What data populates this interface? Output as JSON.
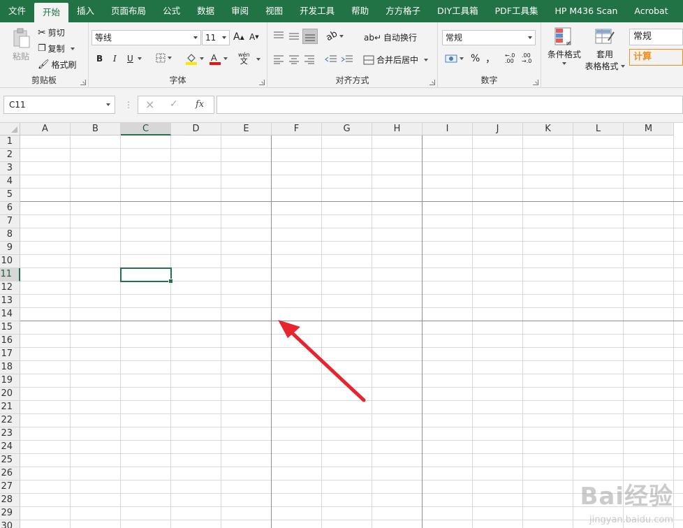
{
  "ribbon_tabs": [
    "文件",
    "开始",
    "插入",
    "页面布局",
    "公式",
    "数据",
    "审阅",
    "视图",
    "开发工具",
    "帮助",
    "方方格子",
    "DIY工具箱",
    "PDF工具集",
    "HP M436 Scan",
    "Acrobat"
  ],
  "active_tab": "开始",
  "clipboard": {
    "paste": "粘贴",
    "cut": "剪切",
    "copy": "复制",
    "format_painter": "格式刷",
    "label": "剪贴板"
  },
  "font": {
    "name": "等线",
    "size": "11",
    "bold": "B",
    "italic": "I",
    "underline": "U",
    "label": "字体",
    "wen": "wén",
    "wen_char": "文"
  },
  "alignment": {
    "wrap": "自动换行",
    "merge": "合并后居中",
    "label": "对齐方式"
  },
  "number": {
    "format": "常规",
    "percent": "%",
    "comma": "，",
    "label": "数字"
  },
  "styles": {
    "conditional": "条件格式",
    "table_1": "套用",
    "table_2": "表格格式",
    "normal": "常规",
    "calculation": "计算"
  },
  "formula_bar": {
    "name_box": "C11",
    "fx": "fx",
    "cancel": "×",
    "confirm": "✓"
  },
  "columns": [
    "A",
    "B",
    "C",
    "D",
    "E",
    "F",
    "G",
    "H",
    "I",
    "J",
    "K",
    "L",
    "M"
  ],
  "rows": [
    "1",
    "2",
    "3",
    "4",
    "5",
    "6",
    "7",
    "8",
    "9",
    "10",
    "11",
    "12",
    "13",
    "14",
    "15",
    "16",
    "17",
    "18",
    "19",
    "20",
    "21",
    "22",
    "23",
    "24",
    "25",
    "26",
    "27",
    "28",
    "29",
    "30"
  ],
  "selected_cell": {
    "column": "C",
    "row": "11"
  },
  "annotation_color": "#e8242f",
  "watermark": {
    "logo": "Bai经验",
    "url": "jingyan.baidu.com"
  }
}
